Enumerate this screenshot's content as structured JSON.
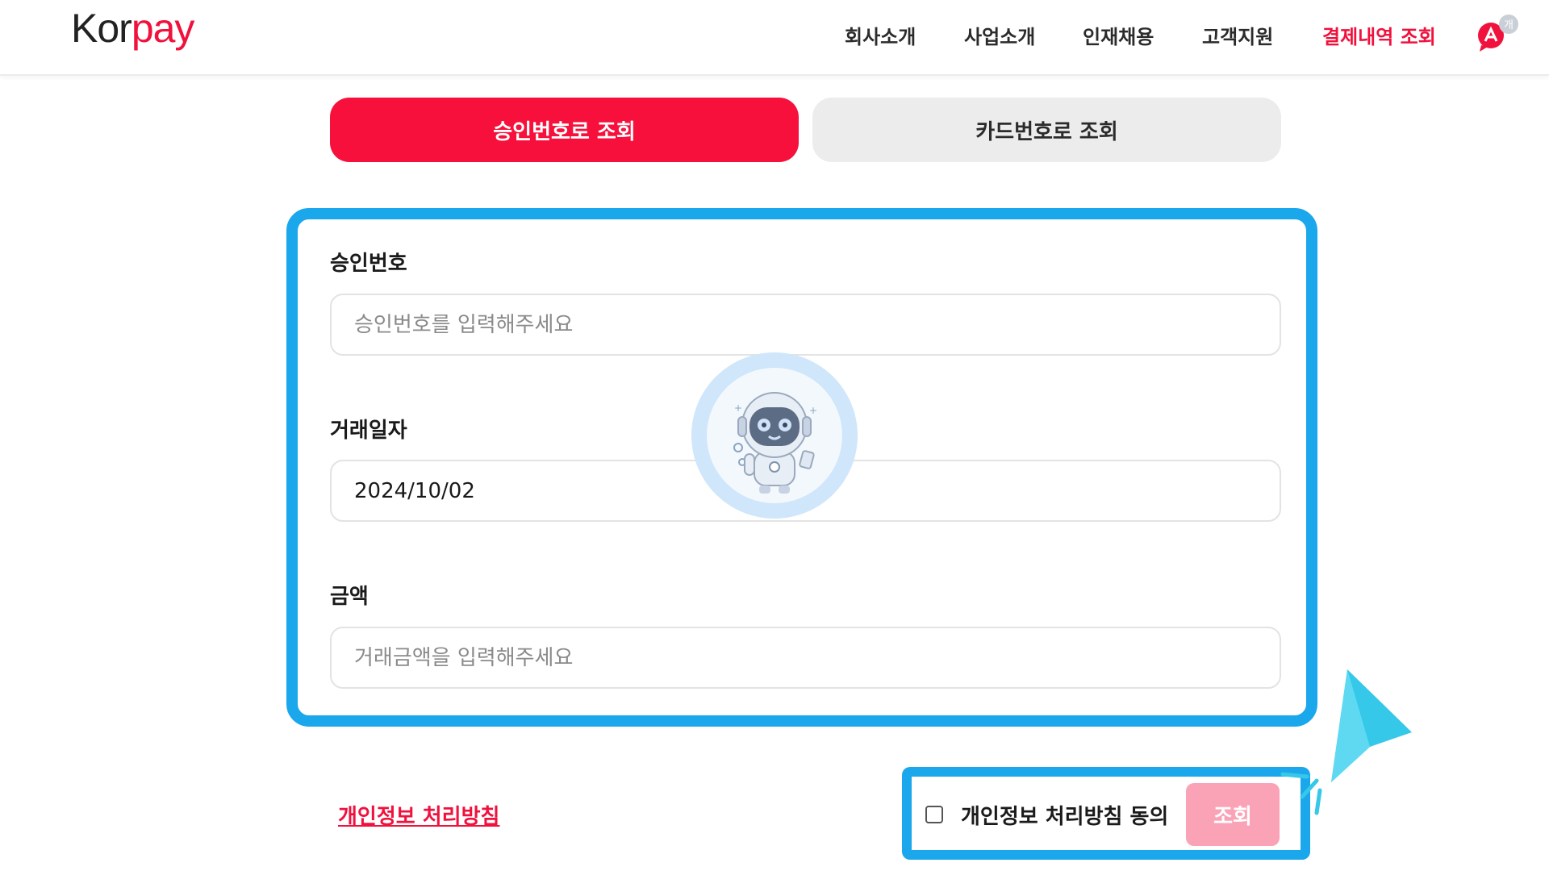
{
  "brand": {
    "logo_prefix": "Kor",
    "logo_suffix": "pay"
  },
  "nav": {
    "items": [
      "회사소개",
      "사업소개",
      "인재채용",
      "고객지원",
      "결제내역 조회"
    ],
    "active_index": 4,
    "chat_badge": "개"
  },
  "tabs": [
    {
      "label": "승인번호로 조회",
      "active": true
    },
    {
      "label": "카드번호로 조회",
      "active": false
    }
  ],
  "form": {
    "approval_label": "승인번호",
    "approval_placeholder": "승인번호를 입력해주세요",
    "approval_value": "",
    "date_label": "거래일자",
    "date_value": "2024/10/02",
    "amount_label": "금액",
    "amount_placeholder": "거래금액을 입력해주세요",
    "amount_value": ""
  },
  "footer": {
    "privacy_link": "개인정보 처리방침",
    "agree_label": "개인정보 처리방침 동의",
    "agree_checked": false,
    "submit_label": "조회"
  },
  "colors": {
    "brand_red": "#f0113d",
    "highlight_blue": "#1aa7ec",
    "submit_disabled": "#fba3b6",
    "tab_inactive": "#ececec"
  }
}
